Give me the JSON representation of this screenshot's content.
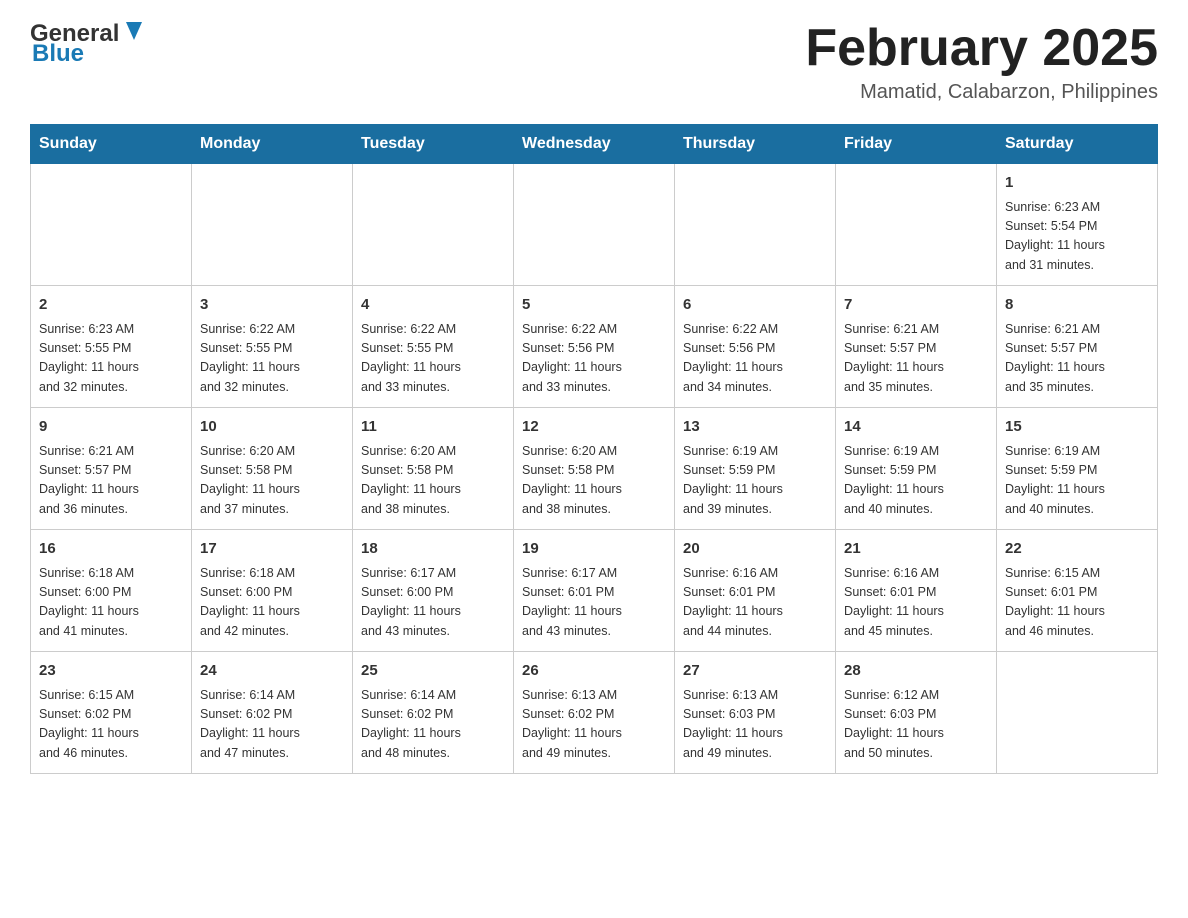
{
  "header": {
    "logo_general": "General",
    "logo_blue": "Blue",
    "month_title": "February 2025",
    "location": "Mamatid, Calabarzon, Philippines"
  },
  "calendar": {
    "days_of_week": [
      "Sunday",
      "Monday",
      "Tuesday",
      "Wednesday",
      "Thursday",
      "Friday",
      "Saturday"
    ],
    "weeks": [
      [
        {
          "day": "",
          "info": ""
        },
        {
          "day": "",
          "info": ""
        },
        {
          "day": "",
          "info": ""
        },
        {
          "day": "",
          "info": ""
        },
        {
          "day": "",
          "info": ""
        },
        {
          "day": "",
          "info": ""
        },
        {
          "day": "1",
          "info": "Sunrise: 6:23 AM\nSunset: 5:54 PM\nDaylight: 11 hours\nand 31 minutes."
        }
      ],
      [
        {
          "day": "2",
          "info": "Sunrise: 6:23 AM\nSunset: 5:55 PM\nDaylight: 11 hours\nand 32 minutes."
        },
        {
          "day": "3",
          "info": "Sunrise: 6:22 AM\nSunset: 5:55 PM\nDaylight: 11 hours\nand 32 minutes."
        },
        {
          "day": "4",
          "info": "Sunrise: 6:22 AM\nSunset: 5:55 PM\nDaylight: 11 hours\nand 33 minutes."
        },
        {
          "day": "5",
          "info": "Sunrise: 6:22 AM\nSunset: 5:56 PM\nDaylight: 11 hours\nand 33 minutes."
        },
        {
          "day": "6",
          "info": "Sunrise: 6:22 AM\nSunset: 5:56 PM\nDaylight: 11 hours\nand 34 minutes."
        },
        {
          "day": "7",
          "info": "Sunrise: 6:21 AM\nSunset: 5:57 PM\nDaylight: 11 hours\nand 35 minutes."
        },
        {
          "day": "8",
          "info": "Sunrise: 6:21 AM\nSunset: 5:57 PM\nDaylight: 11 hours\nand 35 minutes."
        }
      ],
      [
        {
          "day": "9",
          "info": "Sunrise: 6:21 AM\nSunset: 5:57 PM\nDaylight: 11 hours\nand 36 minutes."
        },
        {
          "day": "10",
          "info": "Sunrise: 6:20 AM\nSunset: 5:58 PM\nDaylight: 11 hours\nand 37 minutes."
        },
        {
          "day": "11",
          "info": "Sunrise: 6:20 AM\nSunset: 5:58 PM\nDaylight: 11 hours\nand 38 minutes."
        },
        {
          "day": "12",
          "info": "Sunrise: 6:20 AM\nSunset: 5:58 PM\nDaylight: 11 hours\nand 38 minutes."
        },
        {
          "day": "13",
          "info": "Sunrise: 6:19 AM\nSunset: 5:59 PM\nDaylight: 11 hours\nand 39 minutes."
        },
        {
          "day": "14",
          "info": "Sunrise: 6:19 AM\nSunset: 5:59 PM\nDaylight: 11 hours\nand 40 minutes."
        },
        {
          "day": "15",
          "info": "Sunrise: 6:19 AM\nSunset: 5:59 PM\nDaylight: 11 hours\nand 40 minutes."
        }
      ],
      [
        {
          "day": "16",
          "info": "Sunrise: 6:18 AM\nSunset: 6:00 PM\nDaylight: 11 hours\nand 41 minutes."
        },
        {
          "day": "17",
          "info": "Sunrise: 6:18 AM\nSunset: 6:00 PM\nDaylight: 11 hours\nand 42 minutes."
        },
        {
          "day": "18",
          "info": "Sunrise: 6:17 AM\nSunset: 6:00 PM\nDaylight: 11 hours\nand 43 minutes."
        },
        {
          "day": "19",
          "info": "Sunrise: 6:17 AM\nSunset: 6:01 PM\nDaylight: 11 hours\nand 43 minutes."
        },
        {
          "day": "20",
          "info": "Sunrise: 6:16 AM\nSunset: 6:01 PM\nDaylight: 11 hours\nand 44 minutes."
        },
        {
          "day": "21",
          "info": "Sunrise: 6:16 AM\nSunset: 6:01 PM\nDaylight: 11 hours\nand 45 minutes."
        },
        {
          "day": "22",
          "info": "Sunrise: 6:15 AM\nSunset: 6:01 PM\nDaylight: 11 hours\nand 46 minutes."
        }
      ],
      [
        {
          "day": "23",
          "info": "Sunrise: 6:15 AM\nSunset: 6:02 PM\nDaylight: 11 hours\nand 46 minutes."
        },
        {
          "day": "24",
          "info": "Sunrise: 6:14 AM\nSunset: 6:02 PM\nDaylight: 11 hours\nand 47 minutes."
        },
        {
          "day": "25",
          "info": "Sunrise: 6:14 AM\nSunset: 6:02 PM\nDaylight: 11 hours\nand 48 minutes."
        },
        {
          "day": "26",
          "info": "Sunrise: 6:13 AM\nSunset: 6:02 PM\nDaylight: 11 hours\nand 49 minutes."
        },
        {
          "day": "27",
          "info": "Sunrise: 6:13 AM\nSunset: 6:03 PM\nDaylight: 11 hours\nand 49 minutes."
        },
        {
          "day": "28",
          "info": "Sunrise: 6:12 AM\nSunset: 6:03 PM\nDaylight: 11 hours\nand 50 minutes."
        },
        {
          "day": "",
          "info": ""
        }
      ]
    ]
  }
}
